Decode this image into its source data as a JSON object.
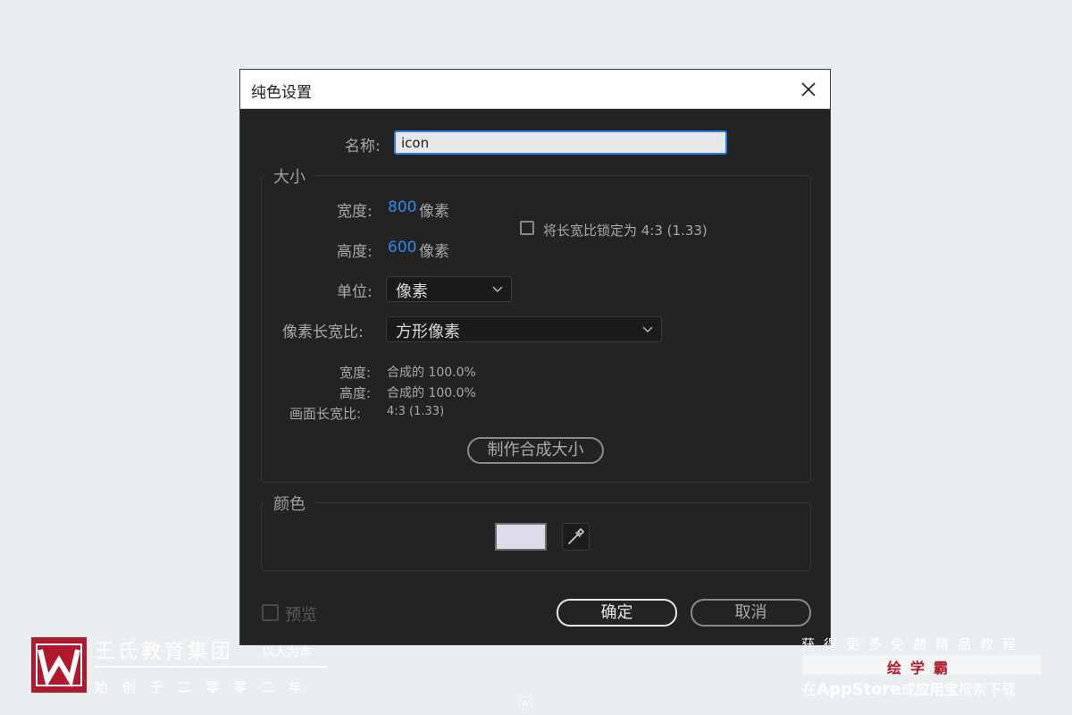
{
  "dialog": {
    "title": "纯色设置",
    "name_label": "名称:",
    "name_value": "icon",
    "size_group": {
      "legend": "大小",
      "width_label": "宽度:",
      "width_value": "800",
      "width_unit": "像素",
      "height_label": "高度:",
      "height_value": "600",
      "height_unit": "像素",
      "lock_aspect_label": "将长宽比锁定为 4:3 (1.33)",
      "unit_label": "单位:",
      "unit_value": "像素",
      "pixel_aspect_label": "像素长宽比:",
      "pixel_aspect_value": "方形像素",
      "info_width_label": "宽度:",
      "info_width_value": "合成的 100.0%",
      "info_height_label": "高度:",
      "info_height_value": "合成的 100.0%",
      "info_frame_label": "画面长宽比:",
      "info_frame_value": "4:3 (1.33)",
      "make_comp_size_button": "制作合成大小"
    },
    "color_group": {
      "legend": "颜色",
      "swatch_color": "#dcdde8"
    },
    "preview_label": "预览",
    "ok_button": "确定",
    "cancel_button": "取消"
  },
  "watermark": {
    "brand_name": "王氏教育集团",
    "slogan": "以人为本",
    "founded": "始创于二零零二年",
    "promo_top": "获得更多免费精品教程",
    "promo_brand": "绘学霸",
    "promo_bottom_1": "在",
    "promo_bottom_2": "AppStore",
    "promo_bottom_3": "或",
    "promo_bottom_4": "应用宝",
    "promo_bottom_5": "搜索下载",
    "center_mark": "ⓦ"
  },
  "colors": {
    "accent": "#2680eb",
    "value_blue": "#2d8ceb",
    "brand_red": "#b0192b"
  }
}
